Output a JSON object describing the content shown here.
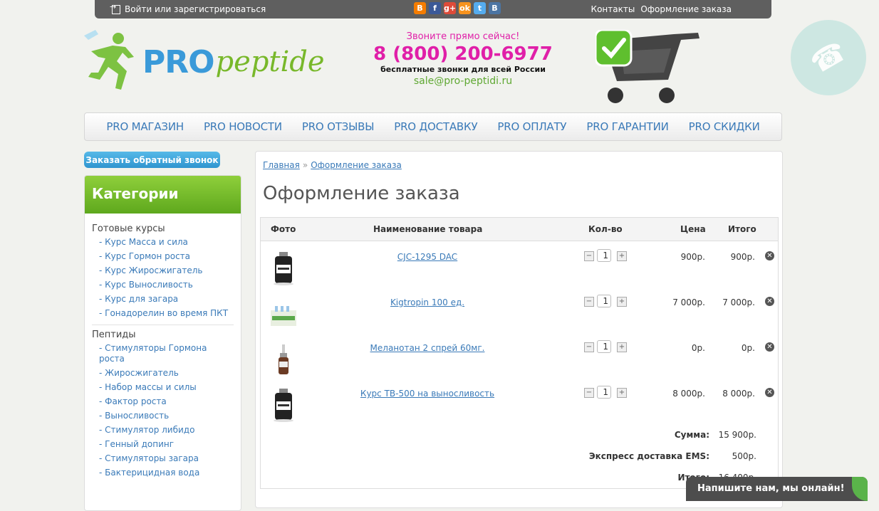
{
  "topbar": {
    "login": "Войти или зарегистрироваться",
    "links": [
      "Контакты",
      "Оформление заказа"
    ],
    "socials": [
      {
        "name": "blogger-icon",
        "glyph": "B",
        "color": "#f57d00"
      },
      {
        "name": "facebook-icon",
        "glyph": "f",
        "color": "#3b5998"
      },
      {
        "name": "google-plus-icon",
        "glyph": "g+",
        "color": "#dd4b39"
      },
      {
        "name": "odnoklassniki-icon",
        "glyph": "ok",
        "color": "#f7931e"
      },
      {
        "name": "twitter-icon",
        "glyph": "t",
        "color": "#55acee"
      },
      {
        "name": "vk-icon",
        "glyph": "B",
        "color": "#4c75a3"
      }
    ]
  },
  "header": {
    "logo_pro": "PRO",
    "logo_peptide": "peptide",
    "call_now": "Звоните прямо сейчас!",
    "phone": "8 (800) 200-6977",
    "free_calls": "бесплатные звонки для всей России",
    "email": "sale@pro-peptidi.ru"
  },
  "nav": [
    "PRO МАГАЗИН",
    "PRO НОВОСТИ",
    "PRO ОТЗЫВЫ",
    "PRO ДОСТАВКУ",
    "PRO ОПЛАТУ",
    "PRO ГАРАНТИИ",
    "PRO СКИДКИ"
  ],
  "sidebar": {
    "callback": "Заказать обратный звонок",
    "categories_title": "Категории",
    "groups": [
      {
        "title": "Готовые курсы",
        "items": [
          "- Курс Масса и сила",
          "- Курс Гормон роста",
          "- Курс Жиросжигатель",
          "- Курс Выносливость",
          "- Курс для загара",
          "- Гонадорелин во время ПКТ"
        ]
      },
      {
        "title": "Пептиды",
        "items": [
          "- Стимуляторы Гормона роста",
          "- Жиросжигатель",
          "- Набор массы и силы",
          "- Фактор роста",
          "- Выносливость",
          "- Стимулятор либидо",
          "- Генный допинг",
          "- Стимуляторы загара",
          "- Бактерицидная вода"
        ]
      }
    ]
  },
  "main": {
    "breadcrumb": [
      "Главная",
      "Оформление заказа"
    ],
    "breadcrumb_sep": "»",
    "title": "Оформление заказа",
    "columns": [
      "Фото",
      "Наименование товара",
      "Кол-во",
      "Цена",
      "Итого"
    ],
    "rows": [
      {
        "name": "CJC-1295 DAC",
        "qty": "1",
        "price": "900р.",
        "total": "900р.",
        "thumb": "vial"
      },
      {
        "name": "Kigtropin 100 ед.",
        "qty": "1",
        "price": "7 000р.",
        "total": "7 000р.",
        "thumb": "box"
      },
      {
        "name": "Меланотан 2 спрей 60мг.",
        "qty": "1",
        "price": "0р.",
        "total": "0р.",
        "thumb": "spray"
      },
      {
        "name": "Курс TB-500 на выносливость",
        "qty": "1",
        "price": "8 000р.",
        "total": "8 000р.",
        "thumb": "vial"
      }
    ],
    "summary": [
      {
        "label": "Сумма:",
        "value": "15 900р."
      },
      {
        "label": "Экспресс доставка EMS:",
        "value": "500р."
      },
      {
        "label": "Итого:",
        "value": "16 400р."
      }
    ]
  },
  "chat": {
    "label": "Напишите нам, мы онлайн!"
  },
  "colors": {
    "accent_blue": "#3a7ab8",
    "brand_green": "#78b82a",
    "phone_pink": "#e01fa8"
  }
}
